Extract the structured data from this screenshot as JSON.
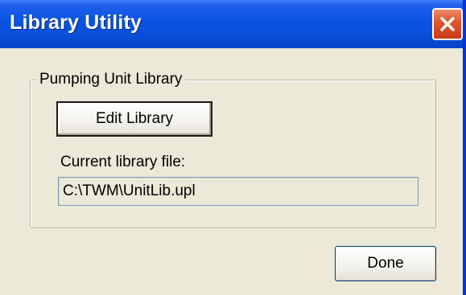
{
  "window": {
    "title": "Library Utility"
  },
  "group": {
    "legend": "Pumping Unit Library",
    "edit_button_label": "Edit Library",
    "current_file_label": "Current library file:",
    "current_file_value": "C:\\TWM\\UnitLib.upl"
  },
  "footer": {
    "done_label": "Done"
  },
  "icons": {
    "close": "close-icon"
  },
  "colors": {
    "titlebar": "#0A55E3",
    "window_bg": "#ECE9D8",
    "close_button": "#E0542B"
  }
}
